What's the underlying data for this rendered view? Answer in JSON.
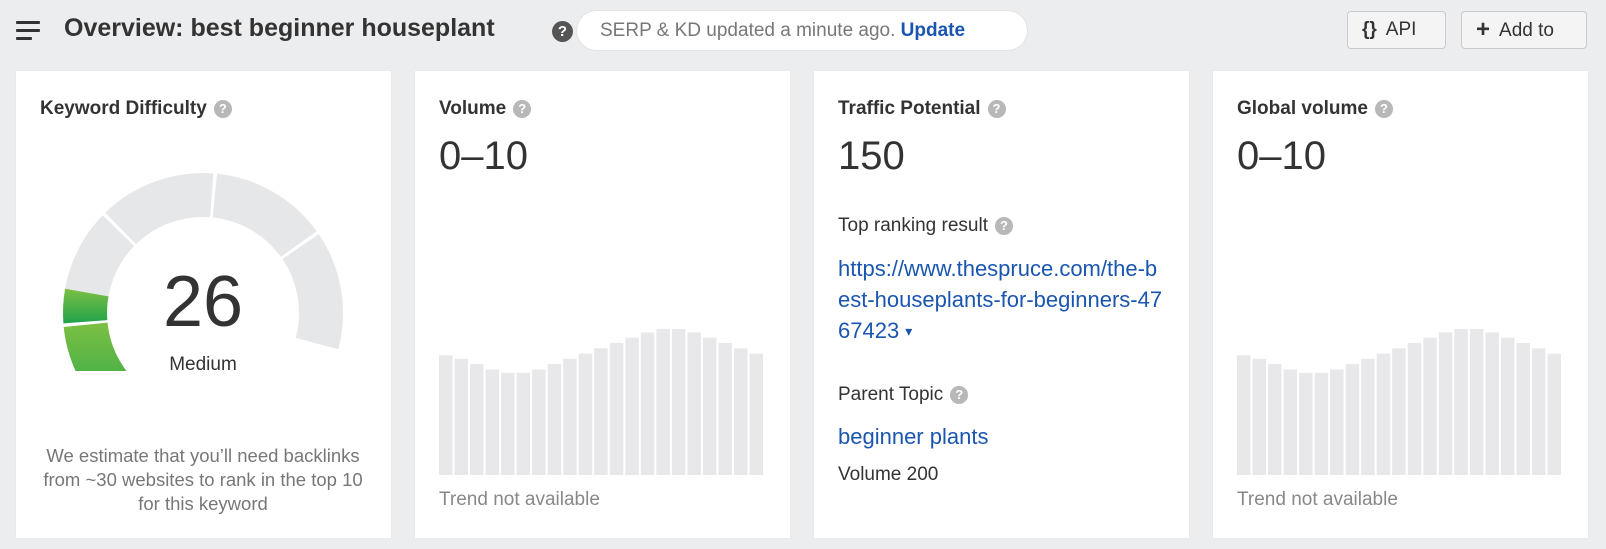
{
  "header": {
    "title": "Overview: best beginner houseplant",
    "serp_status": "SERP & KD updated a minute ago.",
    "update_link": "Update",
    "api_label": "API",
    "api_icon": "{}",
    "add_label": "Add to",
    "add_icon": "+"
  },
  "help_glyph": "?",
  "kd_card": {
    "title": "Keyword Difficulty",
    "score": "26",
    "score_value": 26,
    "rating": "Medium",
    "note": "We estimate that you’ll need backlinks from ~30 websites to rank in the top 10 for this keyword",
    "gauge_colors": {
      "filled": "#1fa34a",
      "filled_light": "#7cc043",
      "empty": "#e6e7e9"
    }
  },
  "volume_card": {
    "title": "Volume",
    "value": "0–10",
    "trend_note": "Trend not available",
    "bar_heights": [
      0.68,
      0.66,
      0.63,
      0.6,
      0.58,
      0.58,
      0.6,
      0.63,
      0.66,
      0.69,
      0.72,
      0.75,
      0.78,
      0.81,
      0.83,
      0.83,
      0.81,
      0.78,
      0.75,
      0.72,
      0.69
    ]
  },
  "traffic_card": {
    "title": "Traffic Potential",
    "value": "150",
    "top_result_label": "Top ranking result",
    "top_result_url": "https://www.thespruce.com/the-best-houseplants-for-beginners-4767423",
    "caret": "▾",
    "parent_topic_label": "Parent Topic",
    "parent_topic": "beginner plants",
    "parent_volume": "Volume 200"
  },
  "global_card": {
    "title": "Global volume",
    "value": "0–10",
    "trend_note": "Trend not available",
    "bar_heights": [
      0.68,
      0.66,
      0.63,
      0.6,
      0.58,
      0.58,
      0.6,
      0.63,
      0.66,
      0.69,
      0.72,
      0.75,
      0.78,
      0.81,
      0.83,
      0.83,
      0.81,
      0.78,
      0.75,
      0.72,
      0.69
    ]
  },
  "colors": {
    "link": "#1a56b0",
    "bar": "#e8e8ea",
    "background": "#ecedef"
  }
}
